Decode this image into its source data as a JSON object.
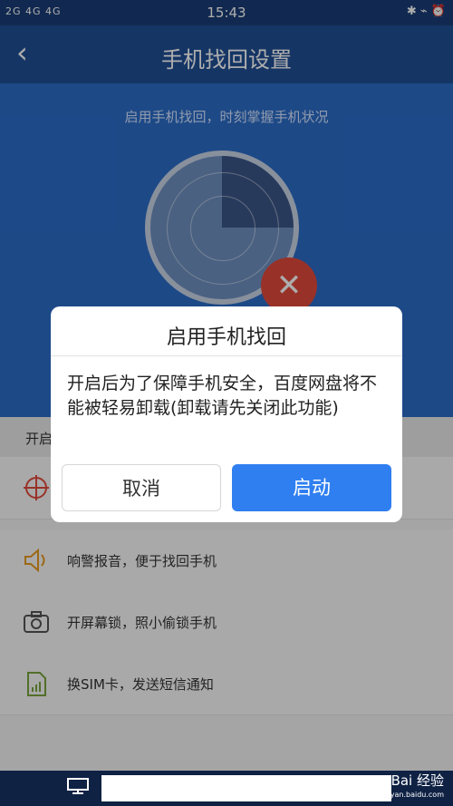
{
  "status": {
    "left": "2G 4G 4G",
    "time": "15:43",
    "right": "✱ ⌁ ⏰"
  },
  "nav": {
    "title": "手机找回设置"
  },
  "hero": {
    "subtitle": "启用手机找回，时刻掌握手机状况"
  },
  "content": {
    "header_partial": "开启",
    "features": [
      {
        "label": ""
      },
      {
        "label": "响警报音，便于找回手机"
      },
      {
        "label": "开屏幕锁，照小偷锁手机"
      },
      {
        "label": "换SIM卡，发送短信通知"
      }
    ]
  },
  "dialog": {
    "title": "启用手机找回",
    "message": "开启后为了保障手机安全，百度网盘将不能被轻易卸载(卸载请先关闭此功能)",
    "cancel": "取消",
    "confirm": "启动"
  },
  "watermark": {
    "main": "Bai 经验",
    "sub": "jingyan.baidu.com"
  },
  "colors": {
    "nav": "#1f4f95",
    "hero": "#2c6cc8",
    "confirm": "#2f7ff0",
    "alert": "#e14a3b"
  },
  "icons": [
    "back-icon",
    "target-icon",
    "speaker-icon",
    "camera-icon",
    "sim-card-icon",
    "monitor-icon",
    "close-icon"
  ]
}
